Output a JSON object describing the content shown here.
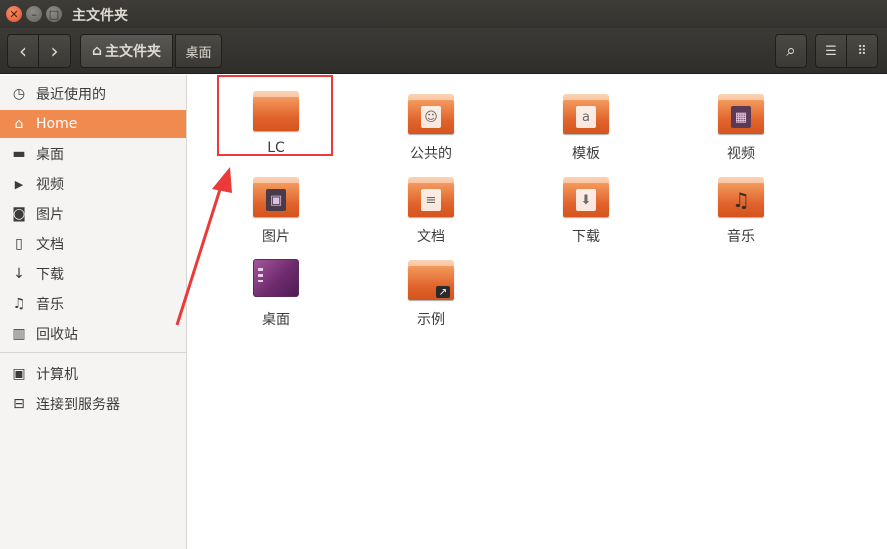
{
  "window": {
    "title": "主文件夹",
    "close_glyph": "✕",
    "minimize_glyph": "–",
    "maximize_glyph": "□"
  },
  "toolbar": {
    "back_icon": "‹",
    "forward_icon": "›",
    "path": [
      {
        "label": "主文件夹",
        "icon": "home-icon",
        "glyph": "⌂",
        "active": true
      },
      {
        "label": "桌面"
      }
    ],
    "search_icon": "⌕",
    "list_view_icon": "☰",
    "grid_view_icon": "⠿"
  },
  "sidebar": {
    "items": [
      {
        "label": "最近使用的",
        "icon": "clock-icon",
        "glyph": "◷"
      },
      {
        "label": "Home",
        "icon": "home-icon",
        "glyph": "⌂",
        "active": true
      },
      {
        "label": "桌面",
        "icon": "folder-icon",
        "glyph": "▬"
      },
      {
        "label": "视频",
        "icon": "video-icon",
        "glyph": "▶"
      },
      {
        "label": "图片",
        "icon": "camera-icon",
        "glyph": "◙"
      },
      {
        "label": "文档",
        "icon": "document-icon",
        "glyph": "▯"
      },
      {
        "label": "下载",
        "icon": "download-icon",
        "glyph": "↓"
      },
      {
        "label": "音乐",
        "icon": "music-icon",
        "glyph": "♫"
      },
      {
        "label": "回收站",
        "icon": "trash-icon",
        "glyph": "▥"
      }
    ],
    "devices": [
      {
        "label": "计算机",
        "icon": "computer-icon",
        "glyph": "▣"
      },
      {
        "label": "连接到服务器",
        "icon": "server-icon",
        "glyph": "⊟"
      }
    ]
  },
  "files": [
    {
      "label": "LC",
      "icon": "folder-icon",
      "emblem": ""
    },
    {
      "label": "公共的",
      "icon": "folder-public-icon",
      "emblem": "☺"
    },
    {
      "label": "模板",
      "icon": "folder-templates-icon",
      "emblem": "a"
    },
    {
      "label": "视频",
      "icon": "folder-videos-icon",
      "emblem": "▦"
    },
    {
      "label": "图片",
      "icon": "folder-pictures-icon",
      "emblem": "▣"
    },
    {
      "label": "文档",
      "icon": "folder-documents-icon",
      "emblem": "≡"
    },
    {
      "label": "下载",
      "icon": "folder-download-icon",
      "emblem": "⬇"
    },
    {
      "label": "音乐",
      "icon": "folder-music-icon",
      "emblem": "♫"
    },
    {
      "label": "桌面",
      "icon": "desktop-icon",
      "emblem": ""
    },
    {
      "label": "示例",
      "icon": "folder-examples-icon",
      "emblem": "↗"
    }
  ],
  "colors": {
    "accent": "#f08a4e",
    "annotation": "#ea3a3a",
    "titlebar": "#3b3a36"
  }
}
